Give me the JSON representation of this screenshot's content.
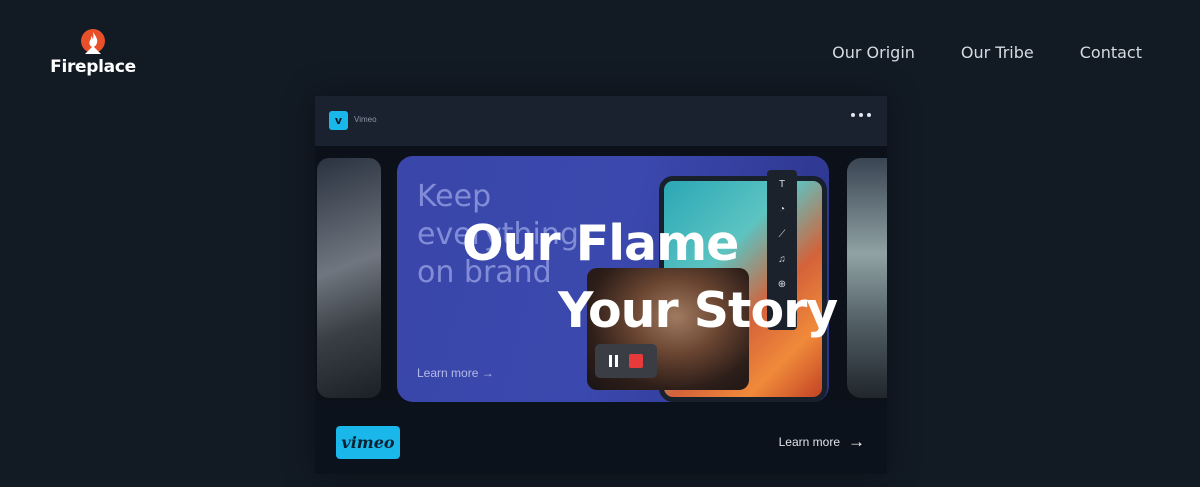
{
  "brand": {
    "name": "Fireplace",
    "accent": "#e8502a"
  },
  "nav": {
    "items": [
      "Our Origin",
      "Our Tribe",
      "Contact"
    ]
  },
  "video": {
    "player_title": "Vimeo",
    "player_badge": "v",
    "banner_text": "Keep everything on brand",
    "banner_link": "Learn more →",
    "toolbar_icons": [
      "T",
      "◔",
      "⟋",
      "♫",
      "⊕"
    ],
    "vimeo_button": "vimeo",
    "learn_more": "Learn more",
    "learn_more_arrow": "→",
    "accent": "#1ab7ea"
  },
  "hero": {
    "line1": "Our Flame",
    "line2": "Your Story"
  },
  "colors": {
    "background": "#121a24",
    "record": "#e83a3a"
  }
}
